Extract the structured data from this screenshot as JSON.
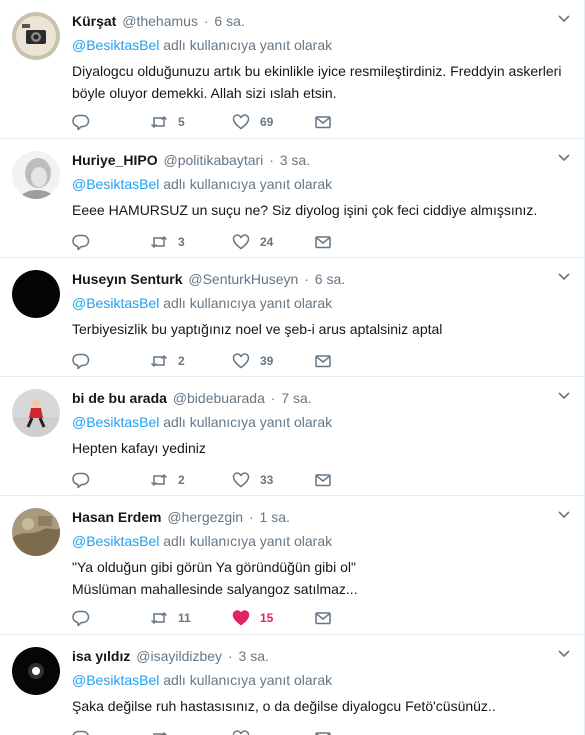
{
  "reply_prefix": "@BesiktasBel",
  "reply_suffix": "adlı kullanıcıya yanıt olarak",
  "tweets": [
    {
      "name": "Kürşat",
      "handle": "@thehamus",
      "time": "6 sa.",
      "lines": [
        "Diyalogcu olduğunuzu artık bu ekinlikle iyice resmileştirdiniz. Freddyin askerleri",
        "böyle oluyor demekki. Allah sizi ıslah etsin."
      ],
      "replies": "",
      "retweets": "5",
      "likes": "69",
      "liked": false
    },
    {
      "name": "Huriye_HIPO",
      "handle": "@politikabaytari",
      "time": "3 sa.",
      "lines": [
        "Eeee HAMURSUZ un suçu ne? Siz diyolog işini çok feci ciddiye almışsınız."
      ],
      "replies": "",
      "retweets": "3",
      "likes": "24",
      "liked": false
    },
    {
      "name": "Huseyın Senturk",
      "handle": "@SenturkHuseyn",
      "time": "6 sa.",
      "lines": [
        "Terbiyesizlik bu yaptığınız noel ve şeb-i arus aptalsiniz aptal"
      ],
      "replies": "",
      "retweets": "2",
      "likes": "39",
      "liked": false
    },
    {
      "name": "bi de bu arada",
      "handle": "@bidebuarada",
      "time": "7 sa.",
      "lines": [
        "Hepten kafayı yediniz"
      ],
      "replies": "",
      "retweets": "2",
      "likes": "33",
      "liked": false
    },
    {
      "name": "Hasan Erdem",
      "handle": "@hergezgin",
      "time": "1 sa.",
      "lines": [
        "\"Ya olduğun gibi görün Ya göründüğün gibi ol\"",
        "Müslüman mahallesinde salyangoz satılmaz..."
      ],
      "replies": "",
      "retweets": "11",
      "likes": "15",
      "liked": true
    },
    {
      "name": "isa yıldız",
      "handle": "@isayildizbey",
      "time": "3 sa.",
      "lines": [
        "Şaka değilse ruh hastasısınız, o da değilse diyalogcu Fetö'cüsünüz.."
      ],
      "replies": "",
      "retweets": "",
      "likes": "",
      "liked": false
    }
  ],
  "colors": {
    "link": "#1da1f2",
    "muted": "#657786",
    "like_active": "#e0245e",
    "border": "#e6ecf0"
  },
  "icons": [
    "reply-icon",
    "retweet-icon",
    "heart-icon",
    "message-icon",
    "chevron-down-icon"
  ]
}
